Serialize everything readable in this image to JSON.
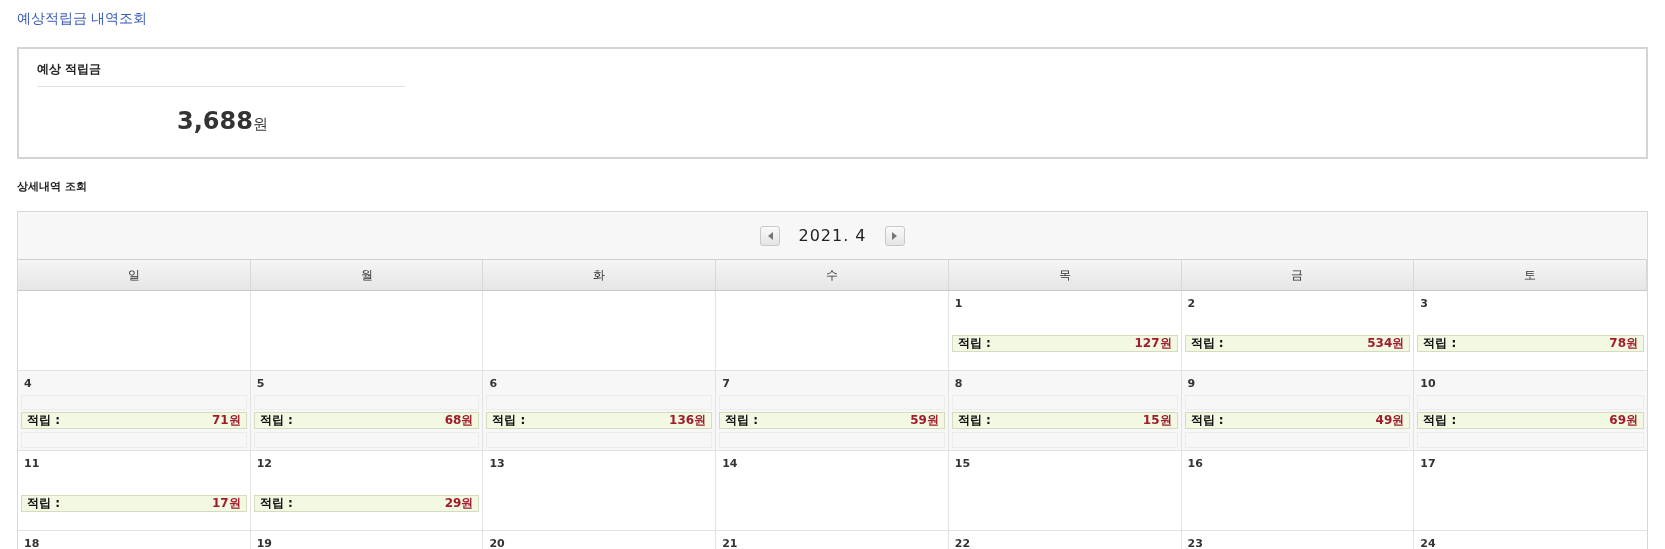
{
  "page_title": "예상적립금 내역조회",
  "summary": {
    "label": "예상 적립금",
    "amount": "3,688",
    "unit": "원"
  },
  "section_title": "상세내역 조회",
  "calendar": {
    "month": "2021. 4",
    "weekdays": [
      "일",
      "월",
      "화",
      "수",
      "목",
      "금",
      "토"
    ],
    "weeks": [
      {
        "shaded": false,
        "days": [
          {
            "kind": "empty"
          },
          {
            "kind": "empty"
          },
          {
            "kind": "empty"
          },
          {
            "kind": "empty"
          },
          {
            "kind": "day",
            "day": "1",
            "entries": [
              {
                "label": "적립 :",
                "amount": "127원"
              }
            ]
          },
          {
            "kind": "day",
            "day": "2",
            "entries": [
              {
                "label": "적립 :",
                "amount": "534원"
              }
            ]
          },
          {
            "kind": "day",
            "day": "3",
            "entries": [
              {
                "label": "적립 :",
                "amount": "78원"
              }
            ]
          }
        ]
      },
      {
        "shaded": true,
        "days": [
          {
            "kind": "day",
            "day": "4",
            "entries": [
              {
                "label": "적립 :",
                "amount": "71원"
              }
            ]
          },
          {
            "kind": "day",
            "day": "5",
            "entries": [
              {
                "label": "적립 :",
                "amount": "68원"
              }
            ]
          },
          {
            "kind": "day",
            "day": "6",
            "entries": [
              {
                "label": "적립 :",
                "amount": "136원"
              }
            ]
          },
          {
            "kind": "day",
            "day": "7",
            "entries": [
              {
                "label": "적립 :",
                "amount": "59원"
              }
            ]
          },
          {
            "kind": "day",
            "day": "8",
            "entries": [
              {
                "label": "적립 :",
                "amount": "15원"
              }
            ]
          },
          {
            "kind": "day",
            "day": "9",
            "entries": [
              {
                "label": "적립 :",
                "amount": "49원"
              }
            ]
          },
          {
            "kind": "day",
            "day": "10",
            "entries": [
              {
                "label": "적립 :",
                "amount": "69원"
              }
            ]
          }
        ]
      },
      {
        "shaded": false,
        "days": [
          {
            "kind": "day",
            "day": "11",
            "entries": [
              {
                "label": "적립 :",
                "amount": "17원"
              }
            ]
          },
          {
            "kind": "day",
            "day": "12",
            "entries": [
              {
                "label": "적립 :",
                "amount": "29원"
              }
            ]
          },
          {
            "kind": "day",
            "day": "13"
          },
          {
            "kind": "day",
            "day": "14"
          },
          {
            "kind": "day",
            "day": "15"
          },
          {
            "kind": "day",
            "day": "16"
          },
          {
            "kind": "day",
            "day": "17"
          }
        ]
      },
      {
        "days": [
          {
            "kind": "day",
            "day": "18"
          },
          {
            "kind": "day",
            "day": "19"
          },
          {
            "kind": "day",
            "day": "20"
          },
          {
            "kind": "day",
            "day": "21"
          },
          {
            "kind": "day",
            "day": "22"
          },
          {
            "kind": "day",
            "day": "23"
          },
          {
            "kind": "day",
            "day": "24"
          }
        ]
      }
    ]
  }
}
